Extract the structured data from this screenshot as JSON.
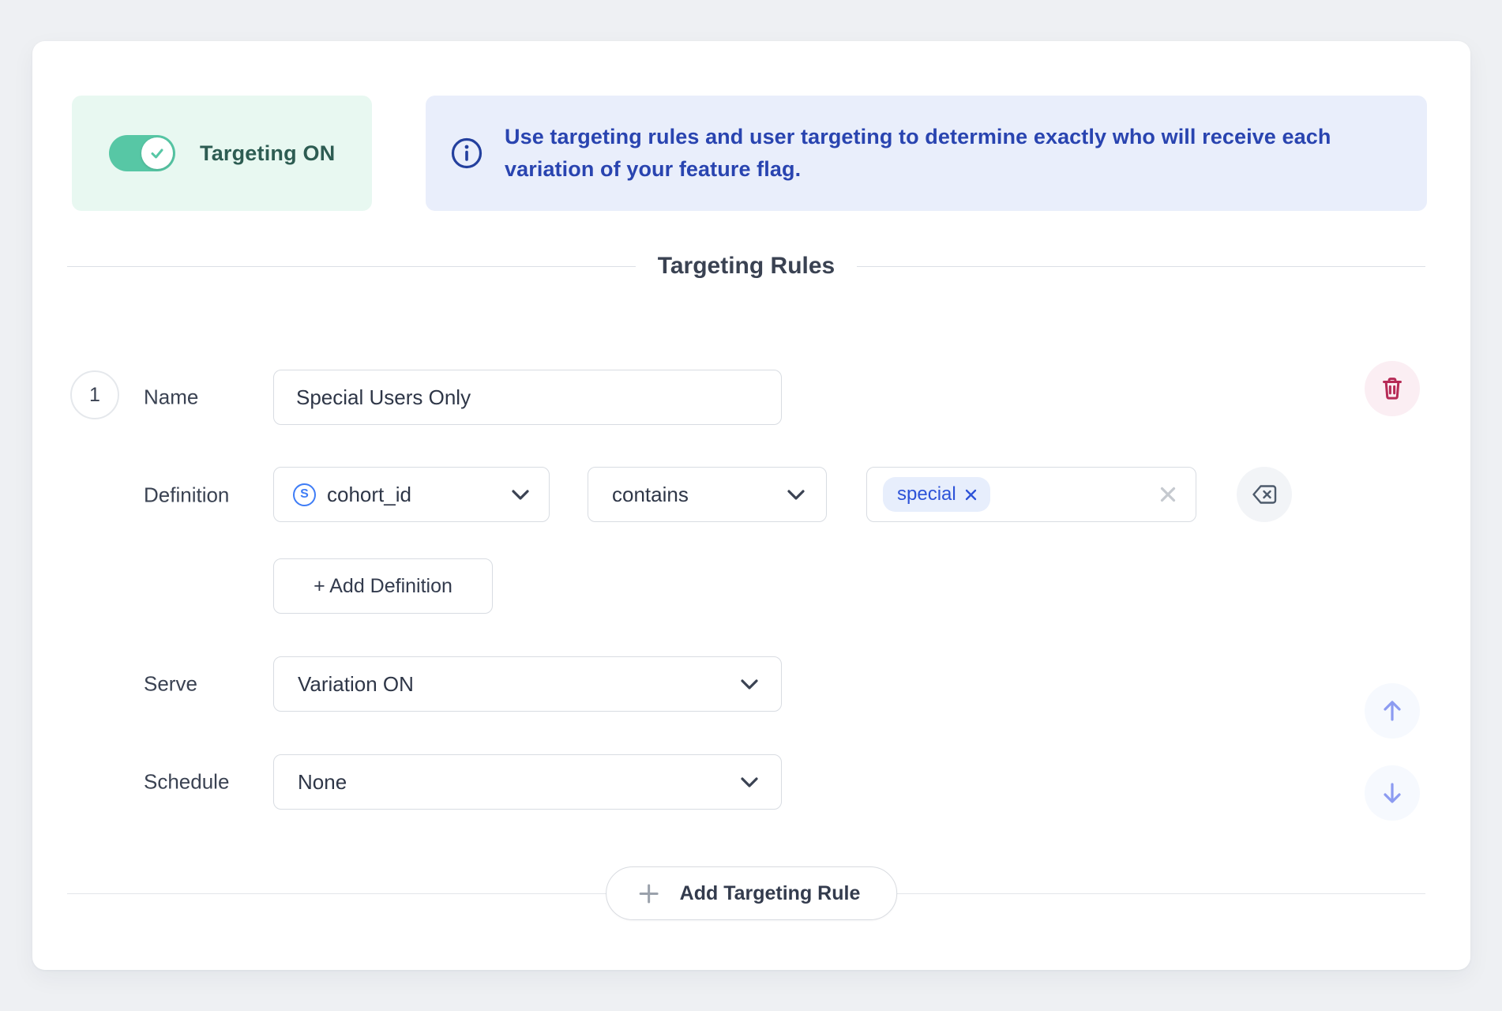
{
  "toggle": {
    "label": "Targeting ON",
    "state": "on"
  },
  "banner": {
    "icon": "info-icon",
    "text": "Use targeting rules and user targeting to determine exactly who will receive each variation of your feature flag."
  },
  "section": {
    "title": "Targeting Rules"
  },
  "rule": {
    "number": "1",
    "fields": {
      "name": {
        "label": "Name",
        "value": "Special Users Only"
      },
      "definition": {
        "label": "Definition",
        "attribute": {
          "icon_letter": "S",
          "value": "cohort_id"
        },
        "operator": {
          "value": "contains"
        },
        "values": {
          "chips": [
            "special"
          ]
        }
      },
      "serve": {
        "label": "Serve",
        "value": "Variation ON"
      },
      "schedule": {
        "label": "Schedule",
        "value": "None"
      }
    },
    "add_definition_label": "+ Add Definition"
  },
  "add_rule": {
    "label": "Add Targeting Rule"
  },
  "colors": {
    "accent_teal": "#57c7a5",
    "toggle_box_bg": "#e8f8f1",
    "banner_bg": "#e9eefb",
    "banner_text": "#2944b0",
    "chip_bg": "#e7eefc",
    "chip_text": "#2d53d8",
    "danger": "#b62a56",
    "danger_bg": "#fbeef3",
    "arrow_blue": "#8c9bf1",
    "attribute_icon_blue": "#3f7df6"
  }
}
